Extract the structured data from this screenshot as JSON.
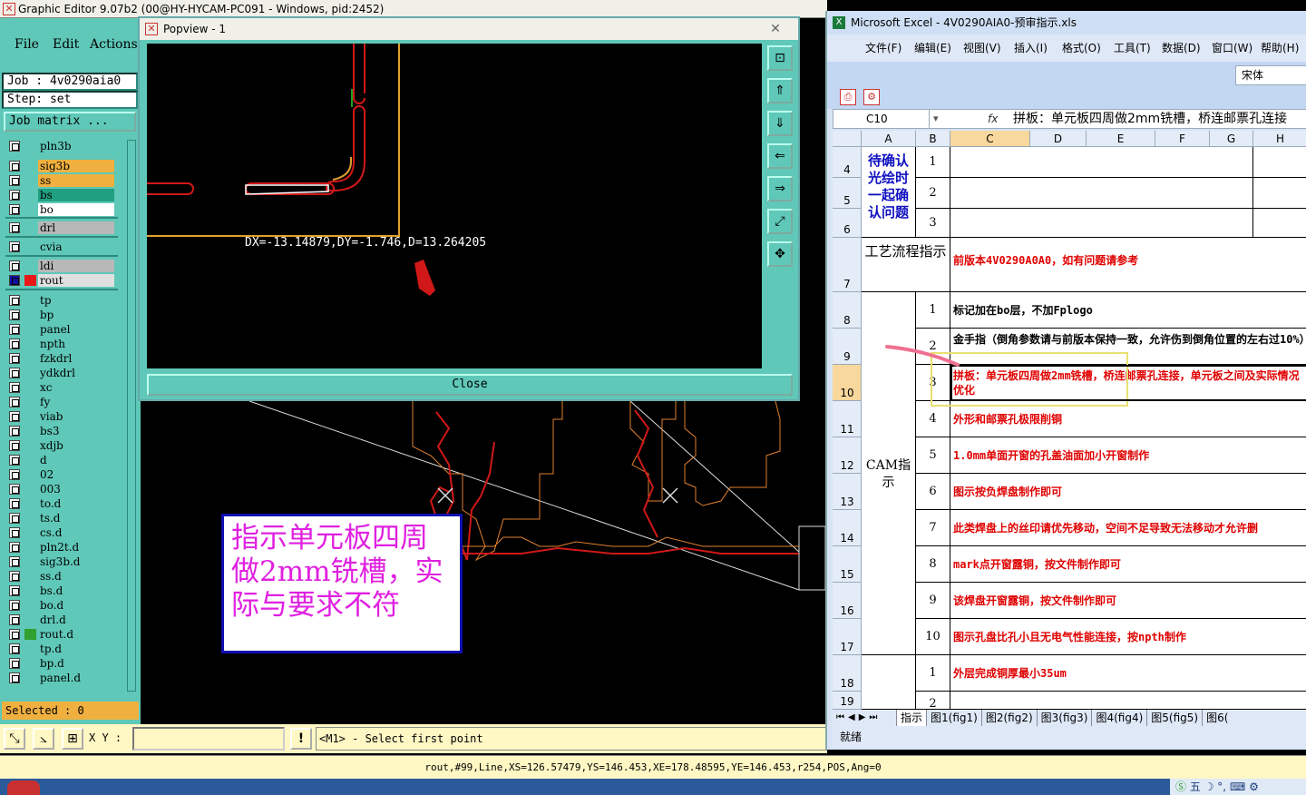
{
  "ge": {
    "title": "Graphic Editor 9.07b2 (00@HY-HYCAM-PC091 - Windows, pid:2452)",
    "menu": [
      "File",
      "Edit",
      "Actions"
    ],
    "job": "Job : 4v0290aia0",
    "step": "Step: set",
    "job_matrix": "Job matrix ...",
    "selected": "Selected : 0",
    "xy_label": "X Y :",
    "xy_value": "",
    "prompt": "<M1> - Select first point",
    "status": "rout,#99,Line,XS=126.57479,YS=146.453,XE=178.48595,YE=146.453,r254,POS,Ang=0",
    "annotation": "指示单元板四周做2mm铣槽，实际与要求不符",
    "layers": [
      {
        "name": "pln3b",
        "color": "#5fc8b8"
      },
      {
        "name": "sig3b",
        "color": "#f0b040"
      },
      {
        "name": "ss",
        "color": "#f0b040"
      },
      {
        "name": "bs",
        "color": "#20a080"
      },
      {
        "name": "bo",
        "color": "#ffffff"
      },
      {
        "name": "drl",
        "color": "#b8b8b8"
      },
      {
        "name": "cvia",
        "color": "#5fc8b8"
      },
      {
        "name": "ldi",
        "color": "#b8b8b8"
      },
      {
        "name": "rout",
        "color": "#e0e0e0"
      },
      {
        "name": "tp",
        "color": "#5fc8b8"
      },
      {
        "name": "bp",
        "color": "#5fc8b8"
      },
      {
        "name": "panel",
        "color": "#5fc8b8"
      },
      {
        "name": "npth",
        "color": "#5fc8b8"
      },
      {
        "name": "fzkdrl",
        "color": "#5fc8b8"
      },
      {
        "name": "ydkdrl",
        "color": "#5fc8b8"
      },
      {
        "name": "xc",
        "color": "#5fc8b8"
      },
      {
        "name": "fy",
        "color": "#5fc8b8"
      },
      {
        "name": "viab",
        "color": "#5fc8b8"
      },
      {
        "name": "bs3",
        "color": "#5fc8b8"
      },
      {
        "name": "xdjb",
        "color": "#5fc8b8"
      },
      {
        "name": "d",
        "color": "#5fc8b8"
      },
      {
        "name": "02",
        "color": "#5fc8b8"
      },
      {
        "name": "003",
        "color": "#5fc8b8"
      },
      {
        "name": "to.d",
        "color": "#5fc8b8"
      },
      {
        "name": "ts.d",
        "color": "#5fc8b8"
      },
      {
        "name": "cs.d",
        "color": "#5fc8b8"
      },
      {
        "name": "pln2t.d",
        "color": "#5fc8b8"
      },
      {
        "name": "sig3b.d",
        "color": "#5fc8b8"
      },
      {
        "name": "ss.d",
        "color": "#5fc8b8"
      },
      {
        "name": "bs.d",
        "color": "#5fc8b8"
      },
      {
        "name": "bo.d",
        "color": "#5fc8b8"
      },
      {
        "name": "drl.d",
        "color": "#5fc8b8"
      },
      {
        "name": "rout.d",
        "color": "#5fc8b8"
      },
      {
        "name": "tp.d",
        "color": "#5fc8b8"
      },
      {
        "name": "bp.d",
        "color": "#5fc8b8"
      },
      {
        "name": "panel.d",
        "color": "#5fc8b8"
      }
    ]
  },
  "popview": {
    "title": "Popview - 1",
    "measure": "DX=-13.14879,DY=-1.746,D=13.264205",
    "close_label": "Close"
  },
  "excel": {
    "title": "Microsoft Excel - 4V0290AIA0-预审指示.xls",
    "menu": [
      "文件(F)",
      "编辑(E)",
      "视图(V)",
      "插入(I)",
      "格式(O)",
      "工具(T)",
      "数据(D)",
      "窗口(W)",
      "帮助(H)"
    ],
    "font_name": "宋体",
    "cell_ref": "C10",
    "formula": "拼板：单元板四周做2mm铣槽，桥连邮票孔连接",
    "columns": [
      "A",
      "B",
      "C",
      "D",
      "E",
      "F",
      "G",
      "H"
    ],
    "row_numbers": [
      "4",
      "5",
      "6",
      "7",
      "8",
      "9",
      "10",
      "11",
      "12",
      "13",
      "14",
      "15",
      "16",
      "17",
      "18",
      "19"
    ],
    "group1_label": "待确认光绘时一起确认问题",
    "group1_nums": [
      "1",
      "2",
      "3"
    ],
    "process_label": "工艺流程指示",
    "process_text": "前版本4V0290A0A0，如有问题请参考",
    "cam_label": "CAM指示",
    "cam_rows": [
      {
        "num": "1",
        "text": "标记加在bo层，不加Fplogo",
        "color": "#000000"
      },
      {
        "num": "2",
        "text": "金手指（倒角参数请与前版本保持一致，允许伤到倒角位置的左右过10%）",
        "color": "#000000"
      },
      {
        "num": "3",
        "text": "拼板：单元板四周做2mm铣槽，桥连邮票孔连接，单元板之间及实际情况优化",
        "color": "#e00000"
      },
      {
        "num": "4",
        "text": "外形和邮票孔极限削铜",
        "color": "#e00000"
      },
      {
        "num": "5",
        "text": "1.0mm单面开窗的孔盖油面加小开窗制作",
        "color": "#e00000"
      },
      {
        "num": "6",
        "text": "图示按负焊盘制作即可",
        "color": "#e00000"
      },
      {
        "num": "7",
        "text": "此类焊盘上的丝印请优先移动，空间不足导致无法移动才允许删",
        "color": "#e00000"
      },
      {
        "num": "8",
        "text": "mark点开窗露铜，按文件制作即可",
        "color": "#e00000"
      },
      {
        "num": "9",
        "text": "该焊盘开窗露铜，按文件制作即可",
        "color": "#e00000"
      },
      {
        "num": "10",
        "text": "图示孔盘比孔小且无电气性能连接，按npth制作",
        "color": "#e00000"
      }
    ],
    "last_rows": [
      {
        "num": "1",
        "text": "外层完成铜厚最小35um",
        "color": "#e00000"
      },
      {
        "num": "2",
        "text": "",
        "color": "#e00000"
      }
    ],
    "sheet_tabs": [
      "指示",
      "图1(fig1)",
      "图2(fig2)",
      "图3(fig3)",
      "图4(fig4)",
      "图5(fig5)",
      "图6("
    ],
    "status": "就绪"
  }
}
